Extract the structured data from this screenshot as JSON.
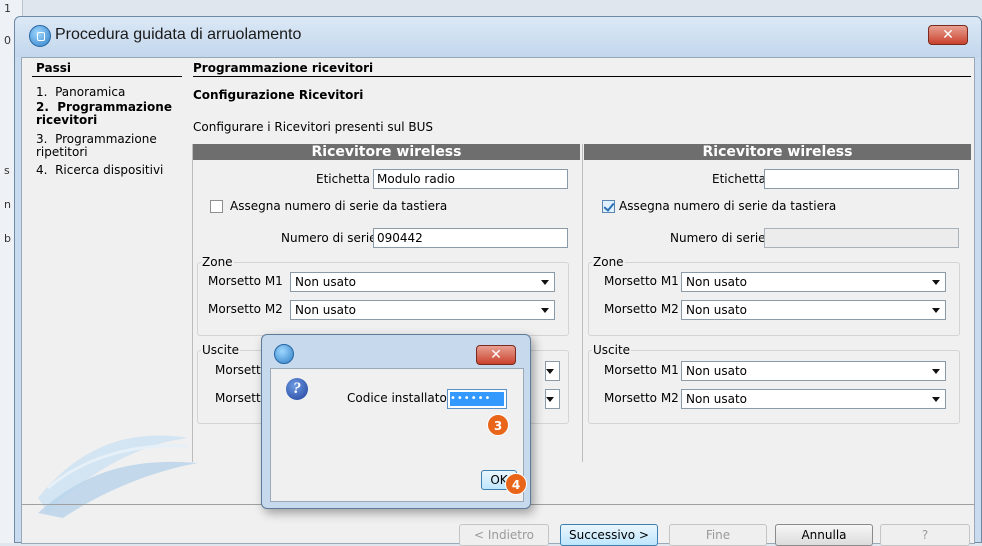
{
  "window": {
    "title": "Procedura guidata di arruolamento"
  },
  "steps": {
    "title": "Passi",
    "items": [
      {
        "label": "1.  Panoramica",
        "current": false
      },
      {
        "label": "2.  Programmazione\nricevitori",
        "current": true
      },
      {
        "label": "3.  Programmazione\nripetitori",
        "current": false
      },
      {
        "label": "4.  Ricerca dispositivi",
        "current": false
      }
    ]
  },
  "section": {
    "title": "Programmazione ricevitori",
    "subtitle": "Configurazione Ricevitori",
    "description": "Configurare i Ricevitori presenti sul BUS"
  },
  "receivers": [
    {
      "header": "Ricevitore wireless",
      "label_caption": "Etichetta",
      "label_value": "Modulo radio",
      "assign_caption": "Assegna numero di serie da tastiera",
      "assign_checked": false,
      "serial_caption": "Numero di serie",
      "serial_value": "090442",
      "zones_title": "Zone",
      "zone_m1_caption": "Morsetto M1",
      "zone_m1_value": "Non usato",
      "zone_m2_caption": "Morsetto M2",
      "zone_m2_value": "Non usato",
      "outputs_title": "Uscite",
      "out_m1_caption": "Morsetto",
      "out_m2_caption": "Morsetto"
    },
    {
      "header": "Ricevitore wireless",
      "label_caption": "Etichetta",
      "label_value": "",
      "assign_caption": "Assegna numero di serie da tastiera",
      "assign_checked": true,
      "serial_caption": "Numero di serie",
      "serial_value": "",
      "zones_title": "Zone",
      "zone_m1_caption": "Morsetto M1",
      "zone_m1_value": "Non usato",
      "zone_m2_caption": "Morsetto M2",
      "zone_m2_value": "Non usato",
      "outputs_title": "Uscite",
      "out_m1_caption": "Morsetto M1",
      "out_m1_value": "Non usato",
      "out_m2_caption": "Morsetto M2",
      "out_m2_value": "Non usato"
    }
  ],
  "buttons": {
    "back": "< Indietro",
    "next": "Successivo >",
    "finish": "Fine",
    "cancel": "Annulla",
    "help": "?"
  },
  "dialog": {
    "code_caption": "Codice installatore",
    "code_value": "••••••",
    "ok": "OK"
  },
  "annotations": {
    "step3": "3",
    "step4": "4",
    "badge_color": "#e8651a"
  },
  "background_app": {
    "fragments": [
      "1",
      "0",
      "s",
      "n",
      "b"
    ]
  }
}
